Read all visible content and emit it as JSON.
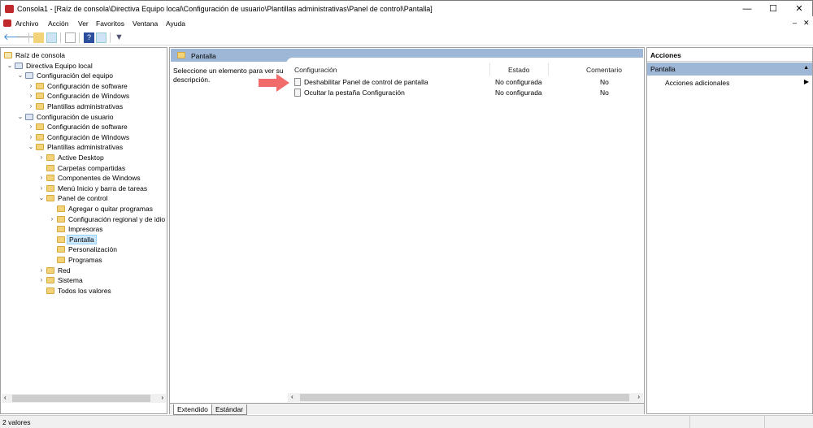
{
  "window": {
    "title": "Consola1 - [Raíz de consola\\Directiva Equipo local\\Configuración de usuario\\Plantillas administrativas\\Panel de control\\Pantalla]",
    "minimize": "—",
    "maximize": "☐",
    "close": "✕"
  },
  "menu": [
    "Archivo",
    "Acción",
    "Ver",
    "Favoritos",
    "Ventana",
    "Ayuda"
  ],
  "tree": [
    {
      "label": "Raíz de consola",
      "level": 0,
      "arrow": ""
    },
    {
      "label": "Directiva Equipo local",
      "level": 1,
      "arrow": "v"
    },
    {
      "label": "Configuración del equipo",
      "level": 2,
      "arrow": "v"
    },
    {
      "label": "Configuración de software",
      "level": 3,
      "arrow": ">"
    },
    {
      "label": "Configuración de Windows",
      "level": 3,
      "arrow": ">"
    },
    {
      "label": "Plantillas administrativas",
      "level": 3,
      "arrow": ">"
    },
    {
      "label": "Configuración de usuario",
      "level": 2,
      "arrow": "v"
    },
    {
      "label": "Configuración de software",
      "level": 3,
      "arrow": ">"
    },
    {
      "label": "Configuración de Windows",
      "level": 3,
      "arrow": ">"
    },
    {
      "label": "Plantillas administrativas",
      "level": 3,
      "arrow": "v"
    },
    {
      "label": "Active Desktop",
      "level": 4,
      "arrow": ">"
    },
    {
      "label": "Carpetas compartidas",
      "level": 4,
      "arrow": ""
    },
    {
      "label": "Componentes de Windows",
      "level": 4,
      "arrow": ">"
    },
    {
      "label": "Menú Inicio y barra de tareas",
      "level": 4,
      "arrow": ">"
    },
    {
      "label": "Panel de control",
      "level": 4,
      "arrow": "v"
    },
    {
      "label": "Agregar o quitar programas",
      "level": 5,
      "arrow": ""
    },
    {
      "label": "Configuración regional y de idio",
      "level": 5,
      "arrow": ">"
    },
    {
      "label": "Impresoras",
      "level": 5,
      "arrow": ""
    },
    {
      "label": "Pantalla",
      "level": 5,
      "arrow": "",
      "selected": true
    },
    {
      "label": "Personalización",
      "level": 5,
      "arrow": ""
    },
    {
      "label": "Programas",
      "level": 5,
      "arrow": ""
    },
    {
      "label": "Red",
      "level": 4,
      "arrow": ">"
    },
    {
      "label": "Sistema",
      "level": 4,
      "arrow": ">"
    },
    {
      "label": "Todos los valores",
      "level": 4,
      "arrow": ""
    }
  ],
  "middle": {
    "header": "Pantalla",
    "description": "Seleccione un elemento para ver su descripción.",
    "columns": [
      "Configuración",
      "Estado",
      "Comentario"
    ],
    "rows": [
      {
        "name": "Deshabilitar Panel de control de pantalla",
        "state": "No configurada",
        "comment": "No"
      },
      {
        "name": "Ocultar la pestaña Configuración",
        "state": "No configurada",
        "comment": "No"
      }
    ],
    "tabs": [
      "Extendido",
      "Estándar"
    ]
  },
  "actions": {
    "title": "Acciones",
    "section": "Pantalla",
    "items": [
      "Acciones adicionales"
    ]
  },
  "status": "2 valores",
  "colors": {
    "accent": "#9fb7d6",
    "arrow": "#f26b6b"
  }
}
